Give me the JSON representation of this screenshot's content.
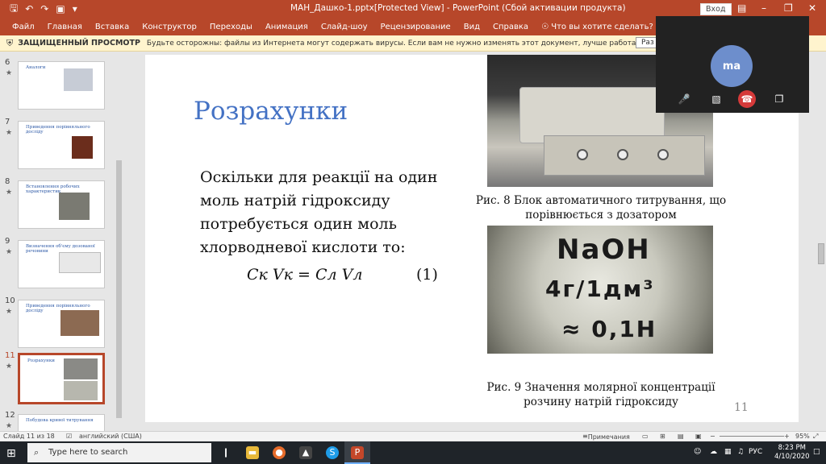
{
  "titlebar": {
    "qat_icons": [
      "save-icon",
      "undo-icon",
      "redo-icon",
      "slideshow-icon",
      "customize-icon"
    ],
    "window_title": "МАН_Дашко-1.pptx[Protected View] - PowerPoint (Сбой активации продукта)",
    "signin": "Вход",
    "window_controls": [
      "ribbon-display-icon",
      "minimize-icon",
      "restore-icon",
      "close-icon"
    ]
  },
  "ribbon": {
    "tabs": [
      "Файл",
      "Главная",
      "Вставка",
      "Конструктор",
      "Переходы",
      "Анимация",
      "Слайд-шоу",
      "Рецензирование",
      "Вид",
      "Справка"
    ],
    "tellme": "Что вы хотите сделать?"
  },
  "protected_view": {
    "title": "ЗАЩИЩЕННЫЙ ПРОСМОТР",
    "message": "Будьте осторожны: файлы из Интернета могут содержать вирусы. Если вам не нужно изменять этот документ, лучше работать с ним в режиме защищенного просмотра.",
    "button": "Раз"
  },
  "thumbnails": [
    {
      "num": "6",
      "title": "Аналоги"
    },
    {
      "num": "7",
      "title": "Приведення порівняльного досліду"
    },
    {
      "num": "8",
      "title": "Встановлення робочих характеристик"
    },
    {
      "num": "9",
      "title": "Визначення об'єму дозованої речовини"
    },
    {
      "num": "10",
      "title": "Приведення порівняльного досліду"
    },
    {
      "num": "11",
      "title": "Розрахунки",
      "selected": true
    },
    {
      "num": "12",
      "title": "Побудова кривої титрування"
    }
  ],
  "slide": {
    "title": "Розрахунки",
    "body_lines": [
      "Оскільки для реакції на один",
      "моль натрій гідроксиду",
      "потребується один моль",
      "хлорводневої кислоти то:"
    ],
    "formula": "Cк Vк = Cл Vл",
    "formula_num": "(1)",
    "caption1_lines": [
      "Рис. 8 Блок автоматичного титрування, що",
      "порівнюється з дозатором"
    ],
    "photo2_text": [
      "NaOH",
      "4г/1дм³",
      "≈ 0,1Н"
    ],
    "caption2_lines": [
      "Рис. 9 Значення молярної концентрації",
      "розчину натрій гідроксиду"
    ],
    "slide_number": "11"
  },
  "meeting": {
    "initials": "ma",
    "buttons": [
      "mic-off-icon",
      "camera-off-icon",
      "hangup-icon",
      "popout-icon"
    ]
  },
  "status": {
    "slide_info": "Слайд 11 из 18",
    "language": "английский (США)",
    "notes": "Примечания",
    "zoom": "95%"
  },
  "taskbar": {
    "search_placeholder": "Type here to search",
    "apps": [
      "task-view-icon",
      "file-explorer-icon",
      "firefox-icon",
      "photos-icon",
      "skype-icon",
      "powerpoint-icon"
    ],
    "lang": "РУС",
    "time": "8:23 PM",
    "date": "4/10/2020"
  }
}
